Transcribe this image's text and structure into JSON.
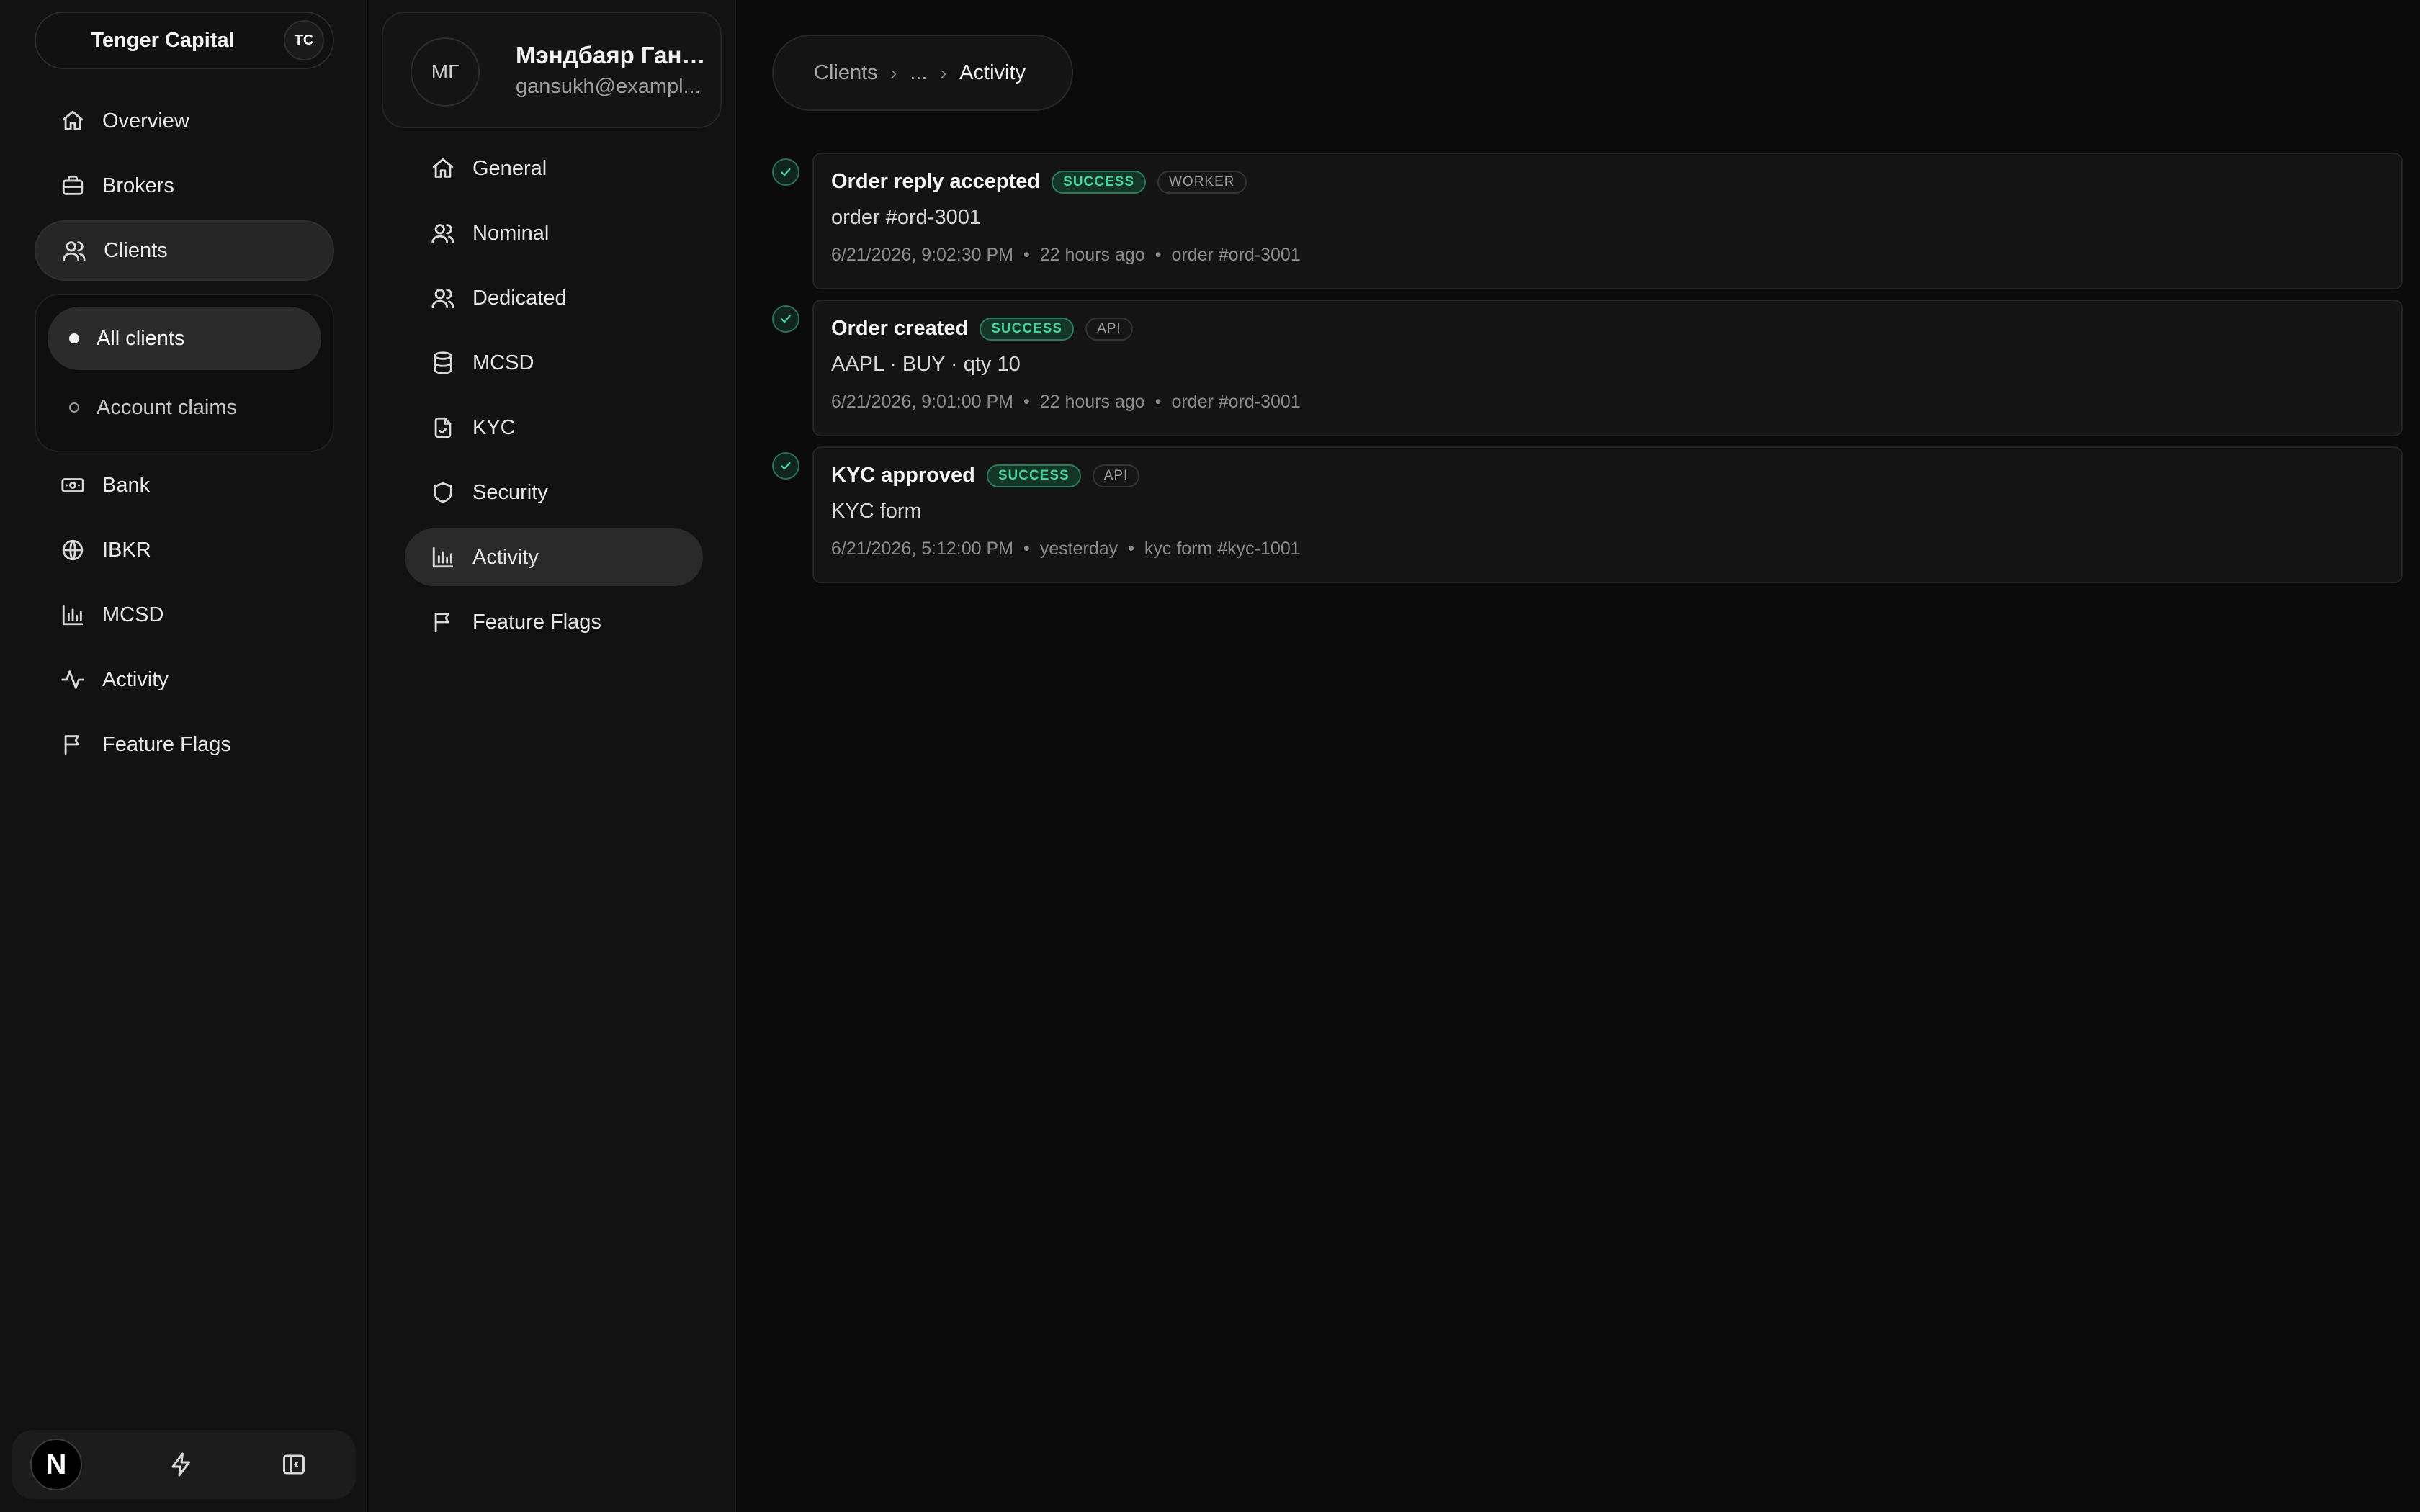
{
  "org": {
    "name": "Tenger Capital",
    "badge": "TC"
  },
  "sidebar": {
    "items": [
      {
        "label": "Overview",
        "icon": "home-icon"
      },
      {
        "label": "Brokers",
        "icon": "briefcase-icon"
      },
      {
        "label": "Clients",
        "icon": "users-icon",
        "active": true
      },
      {
        "label": "Bank",
        "icon": "banknote-icon"
      },
      {
        "label": "IBKR",
        "icon": "globe-icon"
      },
      {
        "label": "MCSD",
        "icon": "bar-chart-icon"
      },
      {
        "label": "Activity",
        "icon": "activity-icon"
      },
      {
        "label": "Feature Flags",
        "icon": "flag-icon"
      }
    ],
    "clients_sub": [
      {
        "label": "All clients",
        "active": true
      },
      {
        "label": "Account claims",
        "active": false
      }
    ]
  },
  "footer": {
    "logo": "N",
    "icons": [
      "bolt-icon",
      "sidebar-toggle-icon"
    ]
  },
  "client": {
    "initials": "МГ",
    "name": "Мэндбаяр Ганс...",
    "email": "gansukh@exampl..."
  },
  "client_nav": [
    {
      "label": "General",
      "icon": "home-icon"
    },
    {
      "label": "Nominal",
      "icon": "users-icon"
    },
    {
      "label": "Dedicated",
      "icon": "users-icon"
    },
    {
      "label": "MCSD",
      "icon": "database-icon"
    },
    {
      "label": "KYC",
      "icon": "file-check-icon"
    },
    {
      "label": "Security",
      "icon": "shield-icon"
    },
    {
      "label": "Activity",
      "icon": "bar-chart-icon",
      "active": true
    },
    {
      "label": "Feature Flags",
      "icon": "flag-icon"
    }
  ],
  "breadcrumb": {
    "root": "Clients",
    "ellipsis": "...",
    "current": "Activity",
    "separator": "›"
  },
  "events": [
    {
      "title": "Order reply accepted",
      "status": "SUCCESS",
      "source": "WORKER",
      "description": "order #ord-3001",
      "timestamp": "6/21/2026, 9:02:30 PM",
      "relative": "22 hours ago",
      "ref": "order #ord-3001"
    },
    {
      "title": "Order created",
      "status": "SUCCESS",
      "source": "API",
      "description": "AAPL · BUY · qty 10",
      "timestamp": "6/21/2026, 9:01:00 PM",
      "relative": "22 hours ago",
      "ref": "order #ord-3001"
    },
    {
      "title": "KYC approved",
      "status": "SUCCESS",
      "source": "API",
      "description": "KYC form",
      "timestamp": "6/21/2026, 5:12:00 PM",
      "relative": "yesterday",
      "ref": "kyc form #kyc-1001"
    }
  ],
  "meta_separator": "•",
  "colors": {
    "background": "#0b0b0b",
    "panel": "#121212",
    "success_text": "#45d49a",
    "success_bg": "#133629",
    "active_item": "#262626"
  }
}
